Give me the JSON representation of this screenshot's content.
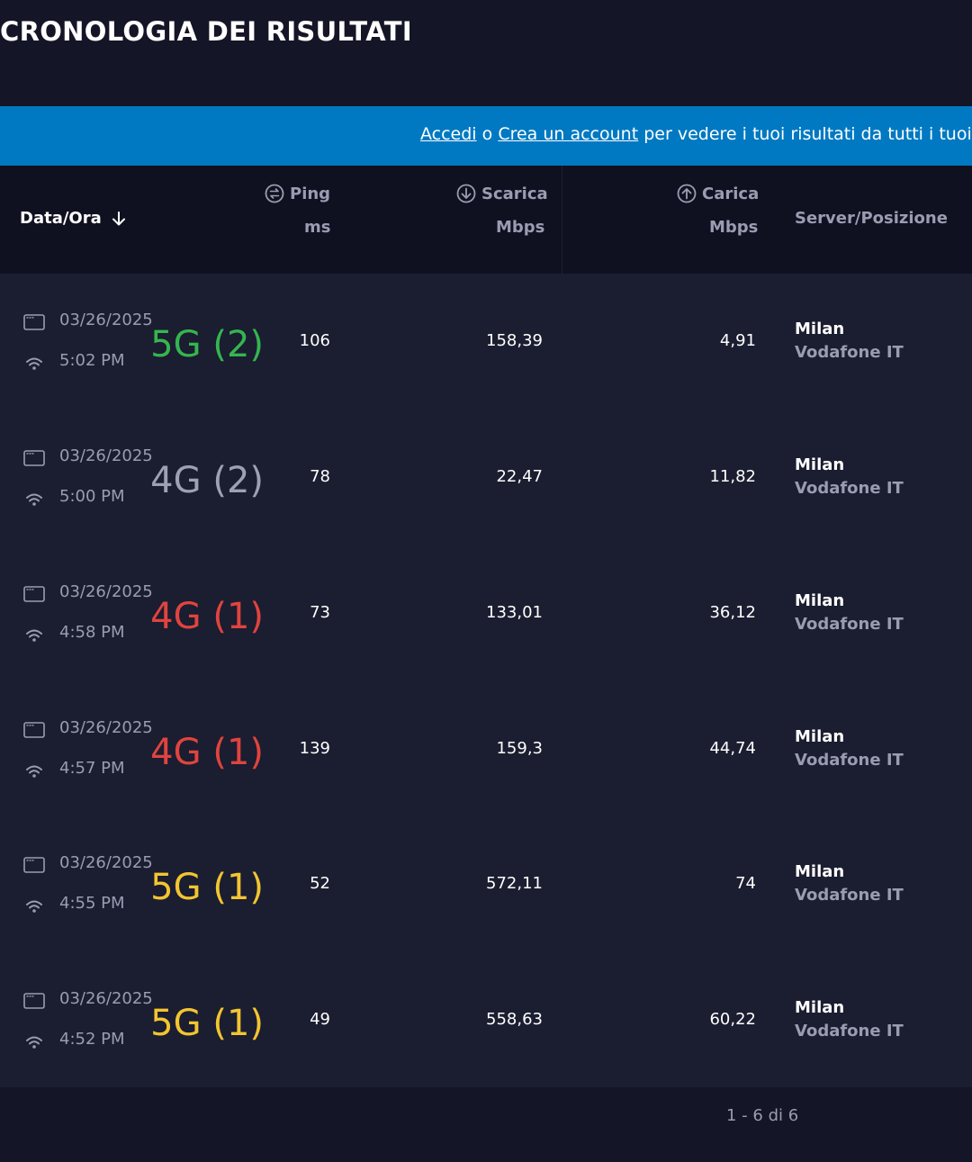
{
  "header": {
    "title": "CRONOLOGIA DEI RISULTATI"
  },
  "banner": {
    "login_link": "Accedi",
    "or_text": "o",
    "signup_link": "Crea un account",
    "message": "per vedere i tuoi risultati da tutti i tuoi dis"
  },
  "table": {
    "columns": {
      "date": "Data/Ora",
      "ping": "Ping",
      "ping_unit": "ms",
      "download": "Scarica",
      "download_unit": "Mbps",
      "upload": "Carica",
      "upload_unit": "Mbps",
      "server": "Server/Posizione"
    },
    "rows": [
      {
        "date": "03/26/2025",
        "time": "5:02 PM",
        "network": "5G (2)",
        "network_color": "#35b54f",
        "ping": "106",
        "download": "158,39",
        "upload": "4,91",
        "city": "Milan",
        "isp": "Vodafone IT"
      },
      {
        "date": "03/26/2025",
        "time": "5:00 PM",
        "network": "4G (2)",
        "network_color": "#9ea1b5",
        "ping": "78",
        "download": "22,47",
        "upload": "11,82",
        "city": "Milan",
        "isp": "Vodafone IT"
      },
      {
        "date": "03/26/2025",
        "time": "4:58 PM",
        "network": "4G (1)",
        "network_color": "#e0443e",
        "ping": "73",
        "download": "133,01",
        "upload": "36,12",
        "city": "Milan",
        "isp": "Vodafone IT"
      },
      {
        "date": "03/26/2025",
        "time": "4:57 PM",
        "network": "4G (1)",
        "network_color": "#e0443e",
        "ping": "139",
        "download": "159,3",
        "upload": "44,74",
        "city": "Milan",
        "isp": "Vodafone IT"
      },
      {
        "date": "03/26/2025",
        "time": "4:55 PM",
        "network": "5G (1)",
        "network_color": "#f2c531",
        "ping": "52",
        "download": "572,11",
        "upload": "74",
        "city": "Milan",
        "isp": "Vodafone IT"
      },
      {
        "date": "03/26/2025",
        "time": "4:52 PM",
        "network": "5G (1)",
        "network_color": "#f2c531",
        "ping": "49",
        "download": "558,63",
        "upload": "60,22",
        "city": "Milan",
        "isp": "Vodafone IT"
      }
    ]
  },
  "footer": {
    "pagination": "1 - 6 di 6"
  },
  "icons": {
    "sort": "arrow-down-icon",
    "ping": "ping-icon",
    "download": "download-icon",
    "upload": "upload-icon",
    "app": "app-window-icon",
    "connection": "wifi-icon"
  }
}
